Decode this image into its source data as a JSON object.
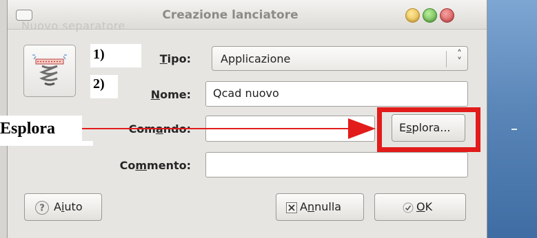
{
  "window": {
    "title": "Creazione lanciatore",
    "ghost_text": "Nuovo separatore"
  },
  "annotations": {
    "step1": "1)",
    "step2": "2)",
    "callout": "Esplora"
  },
  "form": {
    "tipo_label_first": "T",
    "tipo_label_rest": "ipo:",
    "tipo_value": "Applicazione",
    "nome_label_first": "N",
    "nome_label_rest": "ome:",
    "nome_value": "Qcad nuovo",
    "comando_label_pre": "Com",
    "comando_label_u": "a",
    "comando_label_post": "ndo:",
    "comando_value": "",
    "commento_label_pre": "Co",
    "commento_label_u": "m",
    "commento_label_post": "mento:",
    "commento_value": ""
  },
  "buttons": {
    "browse_pre": "E",
    "browse_u": "s",
    "browse_post": "plora...",
    "help_pre": "A",
    "help_u": "i",
    "help_post": "uto",
    "cancel_pre": "A",
    "cancel_u": "n",
    "cancel_post": "nulla",
    "ok_u": "O",
    "ok_post": "K"
  },
  "colors": {
    "highlight": "#e21b1b",
    "window_bg": "#e7e5e2",
    "desktop": "#5a86b8"
  },
  "icons": [
    "launcher-spring-icon",
    "help-icon",
    "cancel-x-icon",
    "ok-check-icon",
    "updown-arrow-icon"
  ]
}
